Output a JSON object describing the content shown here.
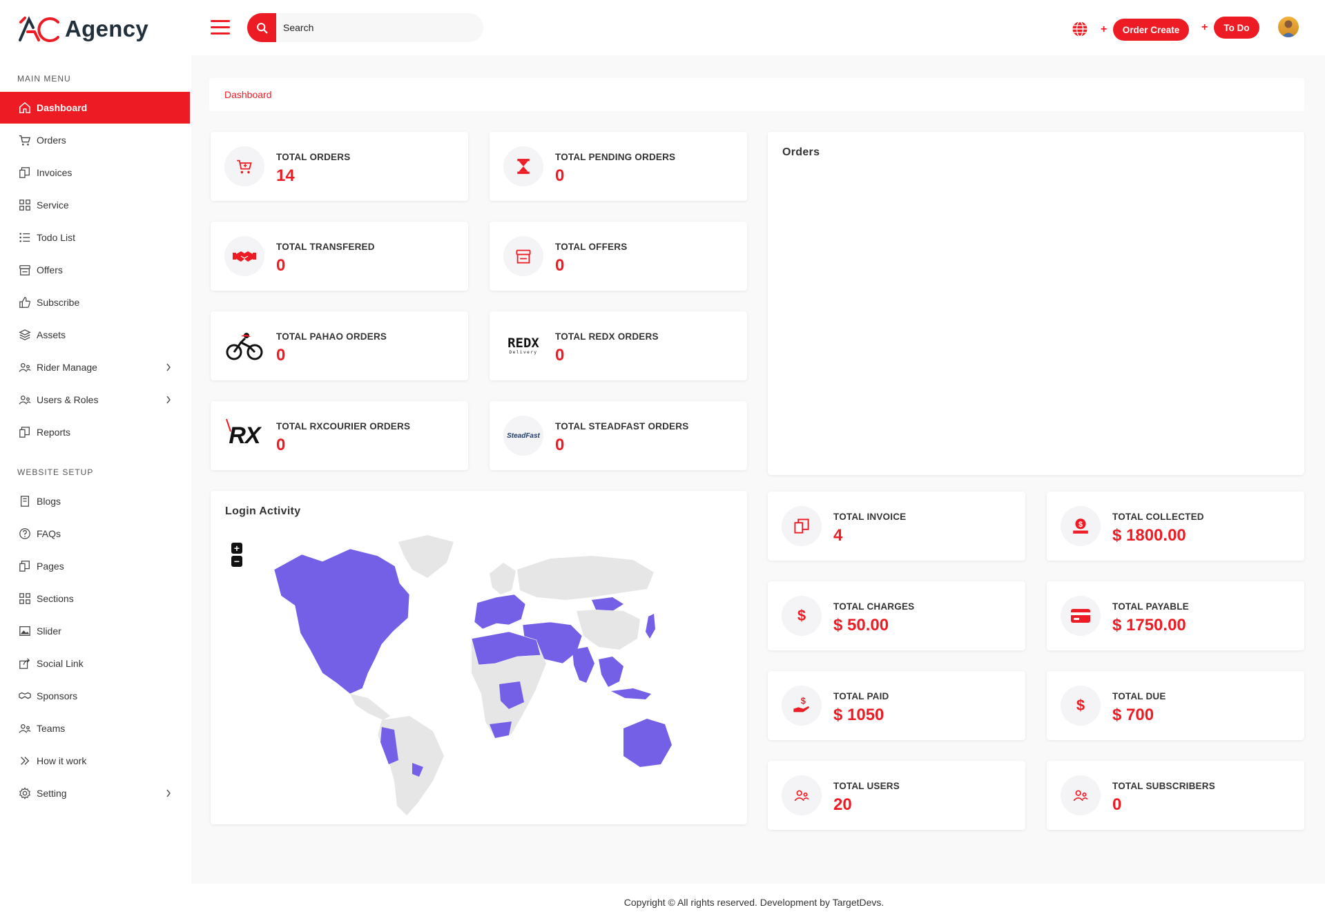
{
  "brand": {
    "name": "Agency"
  },
  "header": {
    "search_placeholder": "Search",
    "order_create_label": "Order Create",
    "todo_label": "To Do",
    "plus_symbol": "+",
    "accent_color": "#ed1c24"
  },
  "sidebar": {
    "main_menu_title": "MAIN MENU",
    "main_items": [
      {
        "label": "Dashboard",
        "icon": "home-icon",
        "active": true
      },
      {
        "label": "Orders",
        "icon": "cart-icon"
      },
      {
        "label": "Invoices",
        "icon": "invoice-icon"
      },
      {
        "label": "Service",
        "icon": "grid-icon"
      },
      {
        "label": "Todo List",
        "icon": "list-icon"
      },
      {
        "label": "Offers",
        "icon": "store-icon"
      },
      {
        "label": "Subscribe",
        "icon": "thumbs-up-icon"
      },
      {
        "label": "Assets",
        "icon": "layers-icon"
      },
      {
        "label": "Rider Manage",
        "icon": "users-icon",
        "has_submenu": true
      },
      {
        "label": "Users & Roles",
        "icon": "users-icon",
        "has_submenu": true
      },
      {
        "label": "Reports",
        "icon": "invoice-icon"
      }
    ],
    "website_setup_title": "WEBSITE SETUP",
    "setup_items": [
      {
        "label": "Blogs",
        "icon": "book-icon"
      },
      {
        "label": "FAQs",
        "icon": "help-circle-icon"
      },
      {
        "label": "Pages",
        "icon": "invoice-icon"
      },
      {
        "label": "Sections",
        "icon": "grid-icon"
      },
      {
        "label": "Slider",
        "icon": "image-icon"
      },
      {
        "label": "Social Link",
        "icon": "share-icon"
      },
      {
        "label": "Sponsors",
        "icon": "handshake-icon"
      },
      {
        "label": "Teams",
        "icon": "users-icon"
      },
      {
        "label": "How it work",
        "icon": "chevrons-right-icon"
      },
      {
        "label": "Setting",
        "icon": "gear-icon",
        "has_submenu": true
      }
    ]
  },
  "breadcrumb": {
    "current": "Dashboard"
  },
  "stats_left": [
    {
      "label": "TOTAL ORDERS",
      "value": "14",
      "icon": "cart-icon"
    },
    {
      "label": "TOTAL PENDING ORDERS",
      "value": "0",
      "icon": "hourglass-icon"
    },
    {
      "label": "TOTAL TRANSFERED",
      "value": "0",
      "icon": "handshake-icon"
    },
    {
      "label": "TOTAL OFFERS",
      "value": "0",
      "icon": "store-icon"
    },
    {
      "label": "TOTAL PAHAO ORDERS",
      "value": "0",
      "icon": "cyclist-logo"
    },
    {
      "label": "TOTAL REDX ORDERS",
      "value": "0",
      "icon": "redx-logo",
      "logo_text": "REDX",
      "logo_sub": "Delivery"
    },
    {
      "label": "TOTAL RXCOURIER ORDERS",
      "value": "0",
      "icon": "rx-logo",
      "logo_text": "RX"
    },
    {
      "label": "TOTAL STEADFAST ORDERS",
      "value": "0",
      "icon": "steadfast-logo",
      "logo_text": "SteadFast"
    }
  ],
  "orders_panel": {
    "title": "Orders"
  },
  "login_activity": {
    "title": "Login Activity",
    "zoom_in": "+",
    "zoom_out": "−",
    "highlight_color": "#7360e6",
    "land_color": "#e6e6e6"
  },
  "stats_right": [
    {
      "label": "TOTAL INVOICE",
      "value": "4",
      "icon": "invoice-icon"
    },
    {
      "label": "TOTAL COLLECTED",
      "value": "$ 1800.00",
      "icon": "coin-hand-icon"
    },
    {
      "label": "TOTAL CHARGES",
      "value": "$ 50.00",
      "icon": "dollar-icon"
    },
    {
      "label": "TOTAL PAYABLE",
      "value": "$ 1750.00",
      "icon": "credit-card-icon"
    },
    {
      "label": "TOTAL PAID",
      "value": "$ 1050",
      "icon": "hand-dollar-icon"
    },
    {
      "label": "TOTAL DUE",
      "value": "$ 700",
      "icon": "dollar-icon"
    },
    {
      "label": "TOTAL USERS",
      "value": "20",
      "icon": "users-icon"
    },
    {
      "label": "TOTAL SUBSCRIBERS",
      "value": "0",
      "icon": "users-icon"
    }
  ],
  "footer": {
    "text": "Copyright © All rights reserved. Development by TargetDevs."
  }
}
